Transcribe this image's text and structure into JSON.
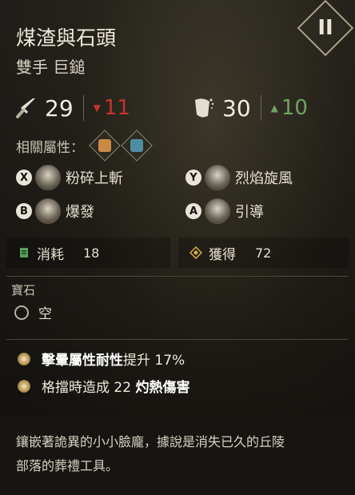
{
  "tier": "II",
  "title": "煤渣與石頭",
  "subtitle": "雙手 巨鎚",
  "stats": {
    "attack": "29",
    "attack_red": "11",
    "defense": "30",
    "defense_green": "10"
  },
  "related_label": "相關屬性：",
  "skills": {
    "x": {
      "button": "X",
      "label": "粉碎上斬"
    },
    "y": {
      "button": "Y",
      "label": "烈焰旋風"
    },
    "b": {
      "button": "B",
      "label": "爆發"
    },
    "a": {
      "button": "A",
      "label": "引導"
    }
  },
  "consume": {
    "label": "消耗",
    "value": "18"
  },
  "gain": {
    "label": "獲得",
    "value": "72"
  },
  "gem": {
    "title": "寶石",
    "slot": "空"
  },
  "bonus1": {
    "bold": "擊暈屬性耐性",
    "rest": "提升 17%"
  },
  "bonus2": {
    "pre": "格擋時造成 22 ",
    "bold": "灼熱傷害"
  },
  "description": {
    "line1": "鑲嵌著詭異的小小臉龐，據說是消失已久的丘陵",
    "line2": "部落的葬禮工具。"
  },
  "colors": {
    "red": "#c7322e",
    "green": "#70a260",
    "gold": "#b8974f"
  }
}
